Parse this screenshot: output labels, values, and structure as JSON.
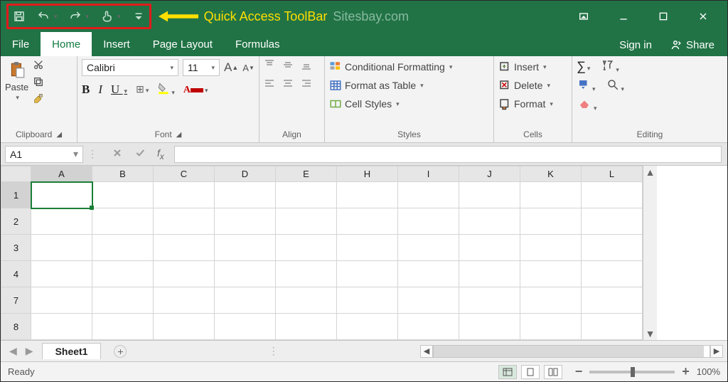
{
  "annotation": {
    "label": "Quick Access ToolBar"
  },
  "site": "Sitesbay.com",
  "tabs": {
    "file": "File",
    "home": "Home",
    "insert": "Insert",
    "pagelayout": "Page Layout",
    "formulas": "Formulas"
  },
  "titleright": {
    "signin": "Sign in",
    "share": "Share"
  },
  "ribbon": {
    "clipboard": {
      "paste": "Paste",
      "label": "Clipboard"
    },
    "font": {
      "name": "Calibri",
      "size": "11",
      "label": "Font"
    },
    "alignment": {
      "label": "Align"
    },
    "styles": {
      "cond": "Conditional Formatting",
      "table": "Format as Table",
      "cell": "Cell Styles",
      "label": "Styles"
    },
    "cells": {
      "insert": "Insert",
      "delete": "Delete",
      "format": "Format",
      "label": "Cells"
    },
    "editing": {
      "label": "Editing"
    }
  },
  "formulabar": {
    "cell": "A1"
  },
  "columns": [
    "A",
    "B",
    "C",
    "D",
    "E",
    "H",
    "I",
    "J",
    "K",
    "L"
  ],
  "rows": [
    "1",
    "2",
    "3",
    "4",
    "7",
    "8"
  ],
  "sheet": {
    "name": "Sheet1"
  },
  "status": {
    "ready": "Ready",
    "zoom": "100%"
  }
}
